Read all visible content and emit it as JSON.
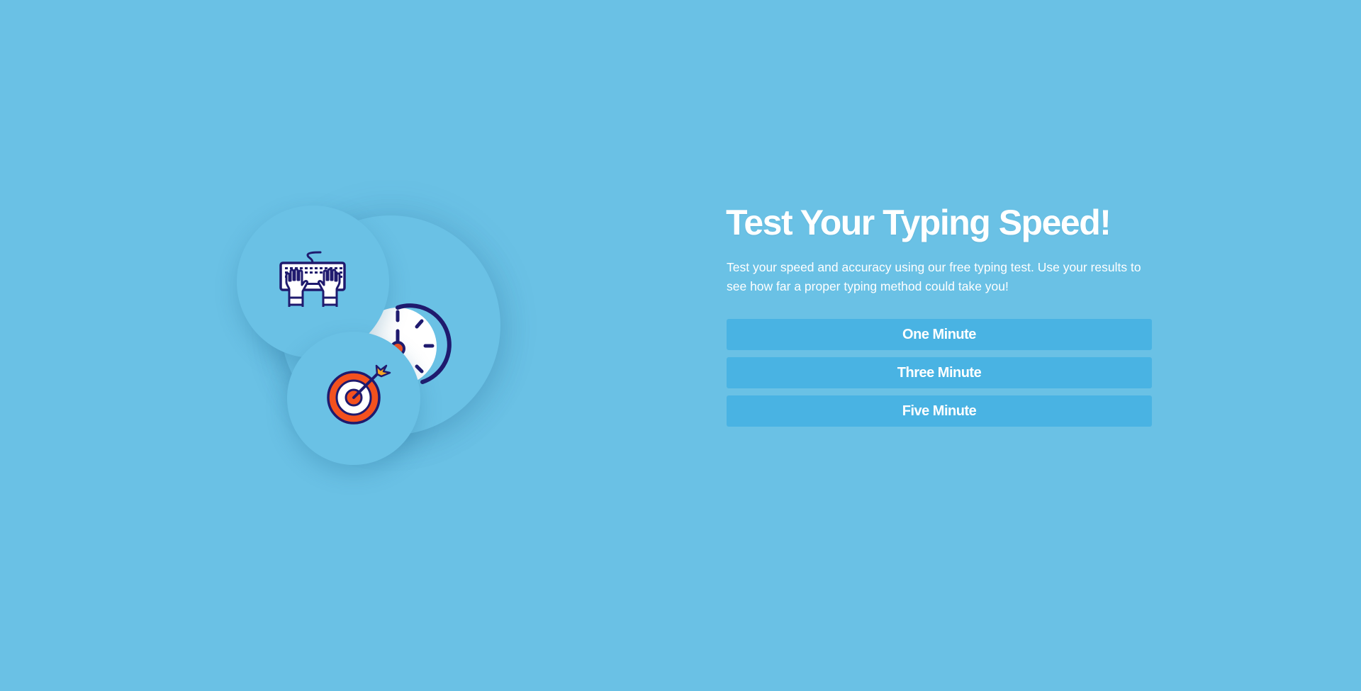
{
  "hero": {
    "title": "Test Your Typing Speed!",
    "subtitle": "Test your speed and accuracy using our free typing test. Use your results to see how far a proper typing method could take you!"
  },
  "buttons": [
    {
      "label": "One Minute"
    },
    {
      "label": "Three Minute"
    },
    {
      "label": "Five Minute"
    }
  ],
  "illustration": {
    "icons": [
      "keyboard-hands-icon",
      "speedometer-icon",
      "target-arrow-icon"
    ]
  },
  "colors": {
    "background": "#6ac1e5",
    "button": "#49b3e3",
    "text": "#ffffff",
    "icon_outline": "#1f1a6e",
    "target_orange": "#f4511e",
    "arrow_fletch": "#f5a623"
  }
}
